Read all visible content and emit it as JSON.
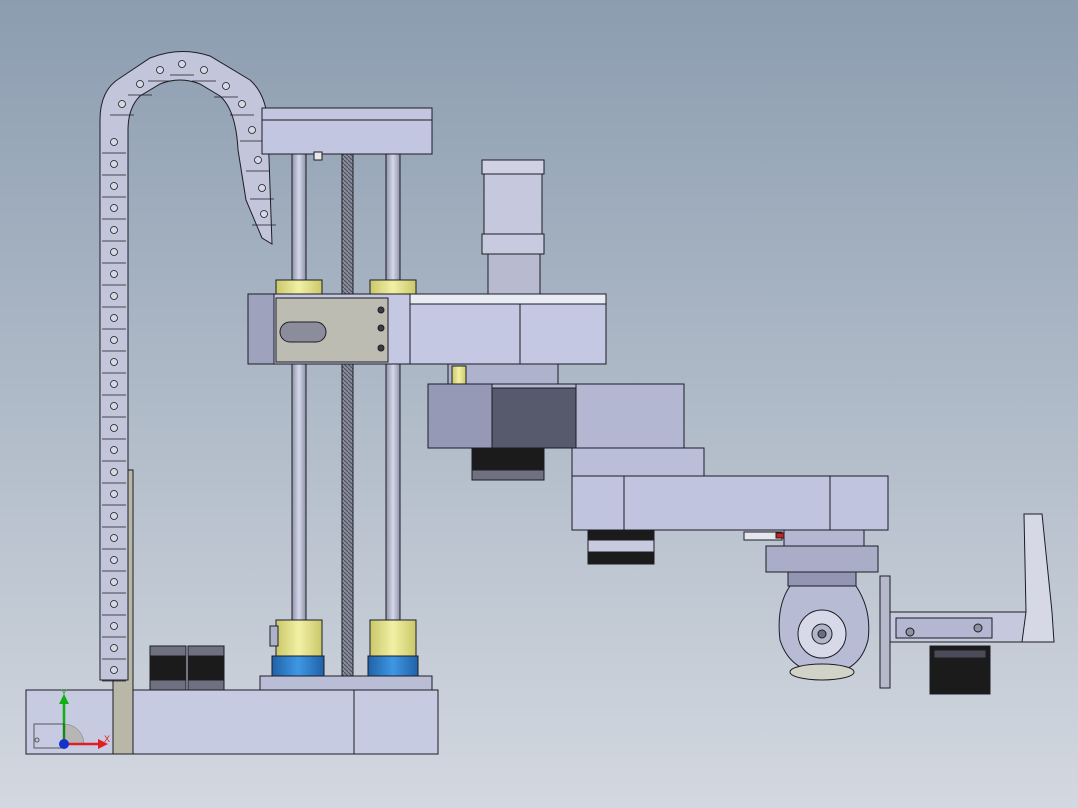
{
  "triad": {
    "x_label": "X",
    "y_label": "Y"
  },
  "colors": {
    "background_top": "#8c9db0",
    "background_bottom": "#d3d8e0",
    "metal_light": "#c4c8e0",
    "metal_mid": "#aeb3d0",
    "metal_dark": "#5a5e72",
    "bushing": "#e6e48c",
    "coupler_blue": "#2f7fcf",
    "motor_black": "#1b1b1b",
    "edge": "#1c1d24",
    "triad_x": "#e02020",
    "triad_y": "#10b010",
    "triad_z": "#1030e0"
  }
}
